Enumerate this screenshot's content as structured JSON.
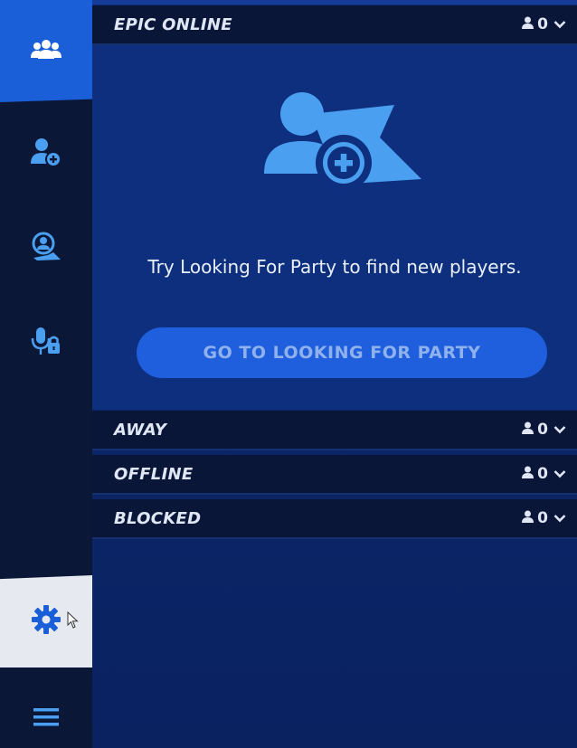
{
  "sidebar": {
    "items": [
      {
        "icon": "friends-icon",
        "active": true
      },
      {
        "icon": "add-friend-icon",
        "active": false
      },
      {
        "icon": "party-finder-icon",
        "active": false
      },
      {
        "icon": "voice-chat-lock-icon",
        "active": false
      }
    ],
    "settings_icon": "gear-icon",
    "menu_icon": "hamburger-menu-icon"
  },
  "sections": {
    "epic_online": {
      "title": "EPIC ONLINE",
      "count": "0"
    },
    "away": {
      "title": "AWAY",
      "count": "0"
    },
    "offline": {
      "title": "OFFLINE",
      "count": "0"
    },
    "blocked": {
      "title": "BLOCKED",
      "count": "0"
    }
  },
  "empty_state": {
    "message": "Try Looking For Party to find new players.",
    "button_label": "GO TO LOOKING FOR PARTY"
  },
  "colors": {
    "accent": "#1f5fdd",
    "icon_blue": "#4a9ff0",
    "header_bg": "#0a1638",
    "panel_bg": "#0d2f7e"
  }
}
